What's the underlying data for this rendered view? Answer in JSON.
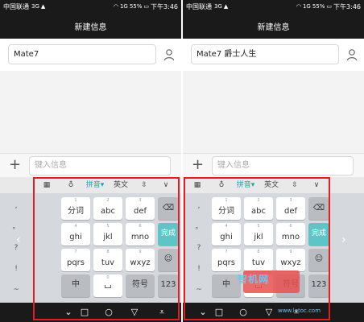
{
  "status_bar": {
    "carrier": "中国联通",
    "network": "3G",
    "signal": "▲",
    "wifi": "◠",
    "sim": "1G",
    "battery_pct": "55%",
    "time": "下午3:46"
  },
  "title": "新建信息",
  "left": {
    "recipient_value": "Mate7",
    "message_placeholder": "键入信息"
  },
  "right": {
    "recipient_value": "Mate7 爵士人生",
    "message_placeholder": "键入信息"
  },
  "toolbar": {
    "pinyin": "拼音",
    "english": "英文"
  },
  "keys": {
    "row1": [
      {
        "num": "1",
        "label": "分词"
      },
      {
        "num": "2",
        "label": "abc"
      },
      {
        "num": "3",
        "label": "def"
      }
    ],
    "row2": [
      {
        "num": "4",
        "label": "ghi"
      },
      {
        "num": "5",
        "label": "jkl"
      },
      {
        "num": "6",
        "label": "mno"
      }
    ],
    "row3": [
      {
        "num": "7",
        "label": "pqrs"
      },
      {
        "num": "8",
        "label": "tuv"
      },
      {
        "num": "9",
        "label": "wxyz"
      }
    ],
    "side": [
      ",",
      "。",
      "?",
      "!",
      "~"
    ],
    "done": "完成",
    "zh": "中",
    "symbols": "符号",
    "num_mode": "123",
    "space_num": "0"
  },
  "watermark": {
    "logo": "智机网",
    "url": "www.lotoc.com"
  },
  "colors": {
    "accent": "#19a1b8",
    "done_key": "#5ec5c7",
    "highlight": "#e02020",
    "bar": "#1a1a1a"
  }
}
